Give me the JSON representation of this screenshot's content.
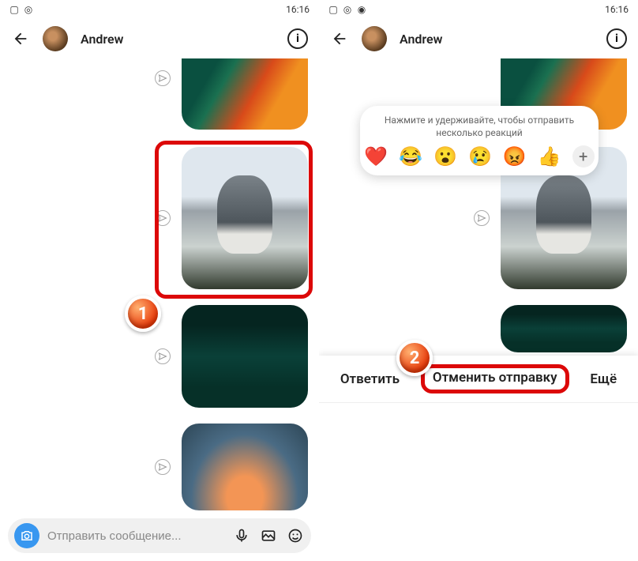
{
  "status": {
    "time": "16:16"
  },
  "header": {
    "name": "Andrew",
    "info_glyph": "i"
  },
  "compose": {
    "placeholder": "Отправить сообщение..."
  },
  "reactions": {
    "tip_line1": "Нажмите и удерживайте, чтобы отправить",
    "tip_line2": "несколько реакций",
    "emojis": [
      "❤️",
      "😂",
      "😮",
      "😢",
      "😡",
      "👍"
    ],
    "plus": "+"
  },
  "actions": {
    "reply": "Ответить",
    "unsend": "Отменить отправку",
    "more": "Ещё"
  },
  "markers": {
    "one": "1",
    "two": "2"
  },
  "messages": [
    "autumn",
    "cat",
    "forest",
    "sunset"
  ]
}
